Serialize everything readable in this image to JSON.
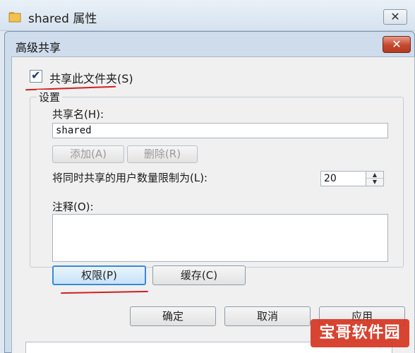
{
  "outer_window": {
    "title": "shared 属性",
    "close_glyph": "✕"
  },
  "dialog": {
    "title": "高级共享",
    "close_glyph": "✕",
    "share_checkbox": {
      "label": "共享此文件夹(S)",
      "checked": true,
      "check_glyph": "✔"
    },
    "settings": {
      "legend": "设置",
      "share_name_label": "共享名(H):",
      "share_name_value": "shared",
      "add_button": "添加(A)",
      "remove_button": "删除(R)",
      "limit_label": "将同时共享的用户数量限制为(L):",
      "limit_value": "20",
      "comment_label": "注释(O):",
      "comment_value": ""
    },
    "permissions_button": "权限(P)",
    "caching_button": "缓存(C)",
    "ok_button": "确定",
    "cancel_button": "取消",
    "apply_button": "应用"
  },
  "watermark": {
    "text": "宝哥软件园"
  },
  "colors": {
    "accent": "#3a8ad6",
    "close_red": "#c5472e",
    "annotation_red": "#d21f1f"
  }
}
